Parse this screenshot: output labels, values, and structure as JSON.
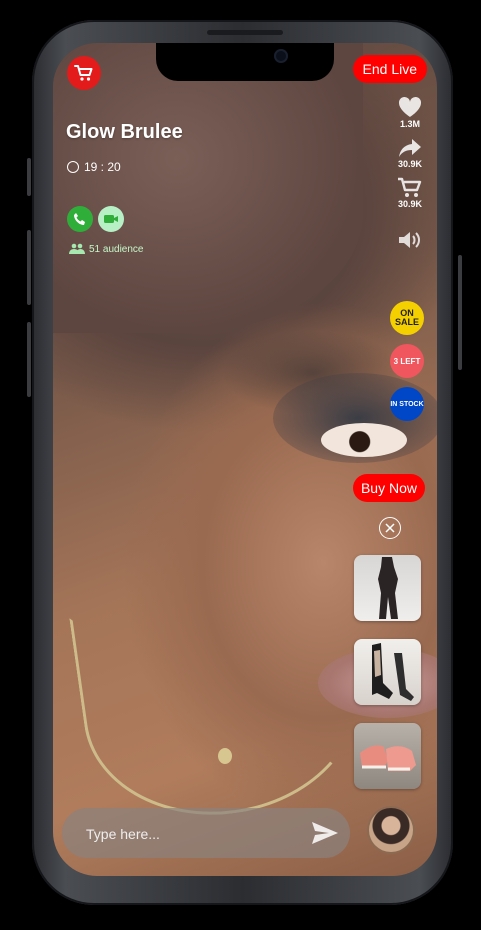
{
  "stream": {
    "title": "Glow Brulee",
    "time": "19 : 20",
    "audience": "51 audience",
    "end_live_label": "End Live"
  },
  "side_actions": [
    {
      "icon": "heart-icon",
      "count": "1.3M"
    },
    {
      "icon": "share-icon",
      "count": "30.9K"
    },
    {
      "icon": "cart-icon",
      "count": "30.9K"
    },
    {
      "icon": "volume-icon",
      "count": ""
    }
  ],
  "badges": {
    "on_sale": "ON SALE",
    "left": "3 LEFT",
    "in_stock": "IN STOCK"
  },
  "buy_now_label": "Buy Now",
  "products": [
    {
      "name": "black-bodysuit"
    },
    {
      "name": "heeled-boots"
    },
    {
      "name": "pink-sneakers"
    }
  ],
  "chat": {
    "placeholder": "Type here..."
  },
  "colors": {
    "accent": "#ff0000",
    "on_sale": "#f5d000",
    "left": "#f0565e",
    "in_stock": "#0047c8",
    "call": "#2fae3a",
    "video": "#b8f0c6"
  }
}
